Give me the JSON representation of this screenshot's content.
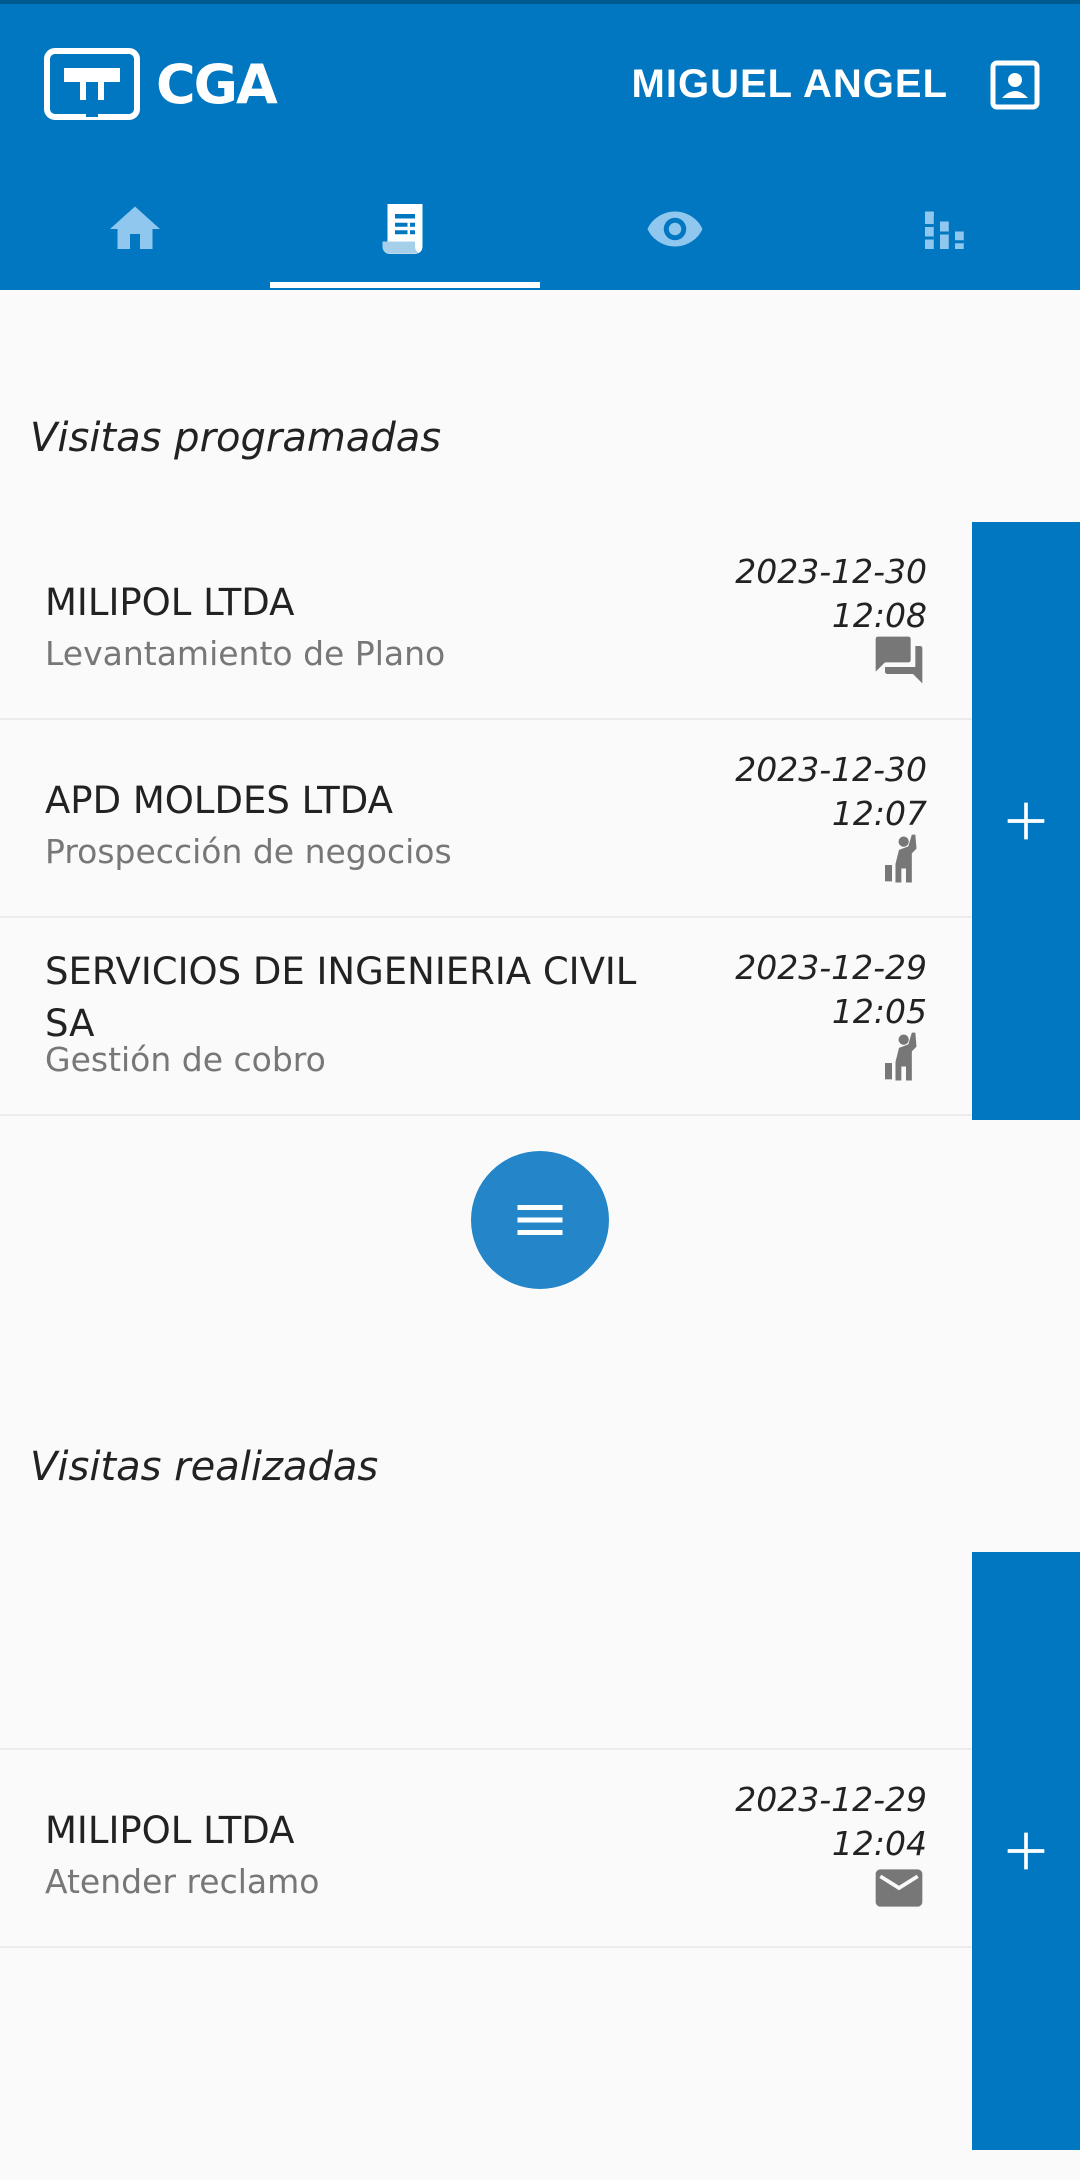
{
  "app": {
    "logo_text": "CGA",
    "user_name": "MIGUEL ANGEL",
    "accent_color": "#0077c0"
  },
  "tabs": [
    {
      "icon": "home-icon",
      "active": false
    },
    {
      "icon": "receipt-icon",
      "active": true
    },
    {
      "icon": "eye-icon",
      "active": false
    },
    {
      "icon": "bar-chart-icon",
      "active": false
    }
  ],
  "scheduled": {
    "title": "Visitas programadas",
    "items": [
      {
        "company": "MILIPOL LTDA",
        "activity": "Levantamiento de Plano",
        "date": "2023-12-30",
        "time": "12:08",
        "icon": "chat-icon"
      },
      {
        "company": "APD MOLDES LTDA",
        "activity": "Prospección de negocios",
        "date": "2023-12-30",
        "time": "12:07",
        "icon": "person-waving-icon"
      },
      {
        "company": "SERVICIOS DE INGENIERIA CIVIL SA",
        "activity": "Gestión de cobro",
        "date": "2023-12-29",
        "time": "12:05",
        "icon": "person-waving-icon"
      }
    ]
  },
  "completed": {
    "title": "Visitas realizadas",
    "items": [
      {
        "company": "MILIPOL LTDA",
        "activity": "Atender reclamo",
        "date": "2023-12-29",
        "time": "12:04",
        "icon": "mail-icon"
      }
    ]
  }
}
